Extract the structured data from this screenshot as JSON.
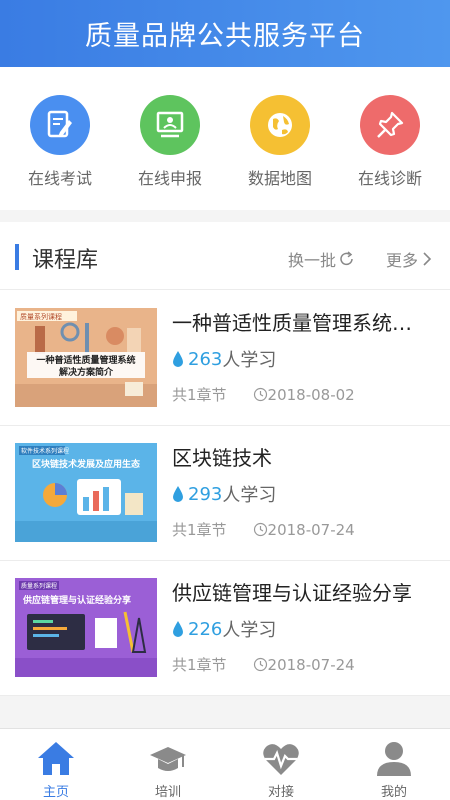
{
  "header": {
    "title": "质量品牌公共服务平台"
  },
  "quick_links": [
    {
      "label": "在线考试",
      "icon": "exam-icon",
      "color": "#4a8ff0"
    },
    {
      "label": "在线申报",
      "icon": "declare-icon",
      "color": "#5ec45e"
    },
    {
      "label": "数据地图",
      "icon": "globe-icon",
      "color": "#f5c033"
    },
    {
      "label": "在线诊断",
      "icon": "pin-icon",
      "color": "#ee6b6b"
    }
  ],
  "course_section": {
    "title": "课程库",
    "refresh_label": "换一批",
    "more_label": "更多"
  },
  "courses": [
    {
      "title": "一种普适性质量管理系统…",
      "learners": "263",
      "learners_suffix": "人学习",
      "chapters": "共1章节",
      "date": "2018-08-02",
      "thumb_tag": "质量系列课程",
      "thumb_line1": "一种普适性质量管理系统",
      "thumb_line2": "解决方案简介",
      "thumb_color": "#e9b48a"
    },
    {
      "title": "区块链技术",
      "learners": "293",
      "learners_suffix": "人学习",
      "chapters": "共1章节",
      "date": "2018-07-24",
      "thumb_tag": "软件技术系列课程",
      "thumb_line1": "区块链技术发展及应用生态",
      "thumb_color": "#5bb4e8"
    },
    {
      "title": "供应链管理与认证经验分享",
      "learners": "226",
      "learners_suffix": "人学习",
      "chapters": "共1章节",
      "date": "2018-07-24",
      "thumb_tag": "质量系列课程",
      "thumb_line1": "供应链管理与认证经验分享",
      "thumb_color": "#9b5fd6"
    }
  ],
  "tabbar": [
    {
      "label": "主页",
      "icon": "home-icon",
      "active": true
    },
    {
      "label": "培训",
      "icon": "graduation-cap-icon",
      "active": false
    },
    {
      "label": "对接",
      "icon": "heartbeat-icon",
      "active": false
    },
    {
      "label": "我的",
      "icon": "user-icon",
      "active": false
    }
  ],
  "colors": {
    "primary": "#3a7ce3",
    "learner_count": "#2f9fe0"
  }
}
